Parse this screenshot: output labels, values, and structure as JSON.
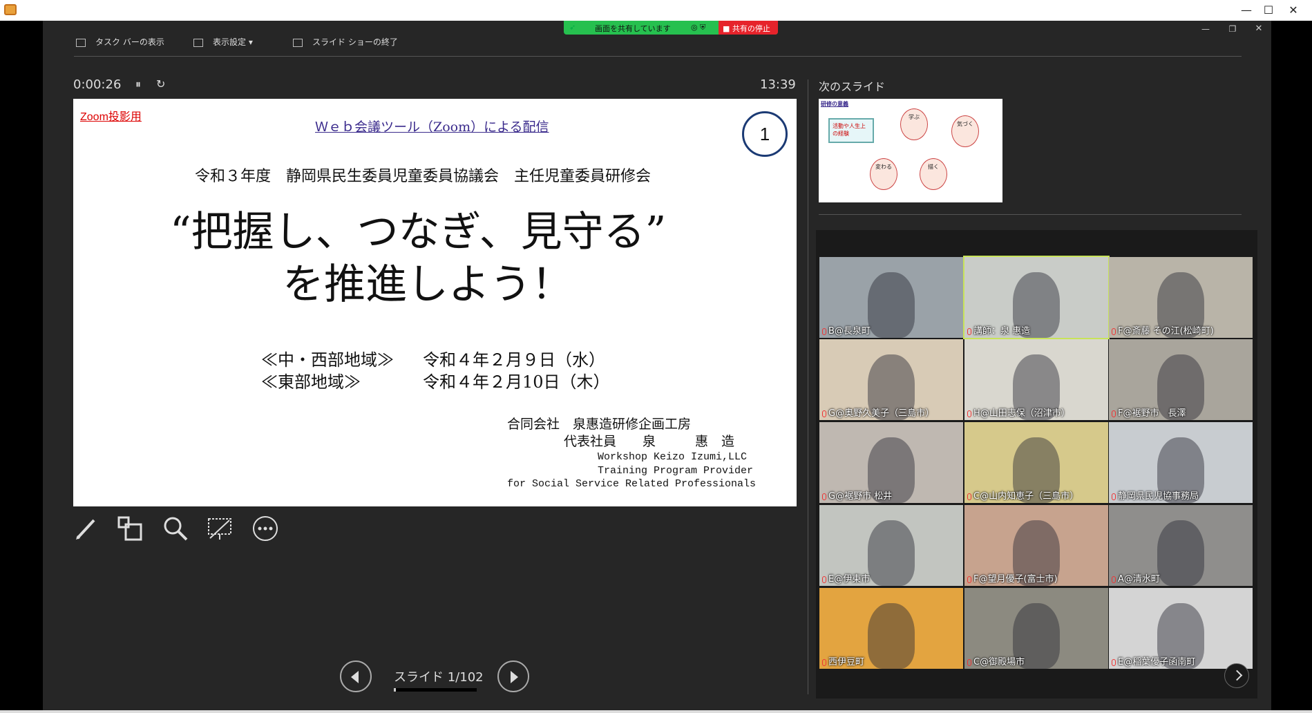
{
  "window": {
    "minimize": "—",
    "maximize": "☐",
    "close": "✕"
  },
  "share_bar": {
    "status": "画面を共有しています",
    "stop": "共有の停止"
  },
  "toolbar": {
    "taskbar": "タスク バーの表示",
    "display_settings": "表示設定 ▾",
    "end_show": "スライド ショーの終了"
  },
  "presenter": {
    "timer": "0:00:26",
    "clock": "13:39",
    "next_slide_label": "次のスライド",
    "slide_counter": "スライド 1/102",
    "progress_fraction": 0.01
  },
  "slide": {
    "zoom_tag": "Zoom投影用",
    "header": "Ｗｅｂ会議ツール（Zoom）による配信",
    "number": "1",
    "subtitle": "令和３年度　静岡県民生委員児童委員協議会　主任児童委員研修会",
    "title1": "“把握し、つなぎ、見守る”",
    "title2": "を推進しよう！",
    "date1_region": "≪中・西部地域≫",
    "date1": "令和４年２月９日（水）",
    "date2_region": "≪東部地域≫",
    "date2": "令和４年２月10日（木）",
    "company": "合同会社　泉惠造研修企画工房",
    "rep": "代表社員　　泉　　　惠　造",
    "en1": "Workshop Keizo Izumi,LLC",
    "en2": "Training Program Provider",
    "en3": "for Social Service Related Professionals"
  },
  "next_thumb": {
    "title": "研修の意義",
    "box1": "活動や人生上の経験",
    "c1": "学ぶ",
    "c2": "気づく",
    "c3": "描く",
    "c4": "変わる"
  },
  "participants": [
    {
      "name": "B@長泉町",
      "bg": "#9aa2a8"
    },
    {
      "name": "講師：泉 惠造",
      "bg": "#c9ccc8"
    },
    {
      "name": "F@斎藤 その江(松崎町)",
      "bg": "#b9b4a8"
    },
    {
      "name": "G@奥野久美子（三島市）",
      "bg": "#d8cbb6"
    },
    {
      "name": "H@山田志保（沼津市）",
      "bg": "#d9d7cf"
    },
    {
      "name": "F@裾野市　長澤",
      "bg": "#a9a59c"
    },
    {
      "name": "G@裾野市 松井",
      "bg": "#bfb8b1"
    },
    {
      "name": "C@山内知恵子（三島市）",
      "bg": "#d6c98b"
    },
    {
      "name": "静岡県民児協事務局",
      "bg": "#c8ccd0"
    },
    {
      "name": "E@伊東市",
      "bg": "#c2c5c0"
    },
    {
      "name": "F@望月優子(富士市)",
      "bg": "#c7a38e"
    },
    {
      "name": "A@清水町",
      "bg": "#8f8e8c"
    },
    {
      "name": "西伊豆町",
      "bg": "#e3a440"
    },
    {
      "name": "C@御殿場市",
      "bg": "#8c8a80"
    },
    {
      "name": "E@稲葉優子函南町",
      "bg": "#d4d4d4"
    }
  ]
}
